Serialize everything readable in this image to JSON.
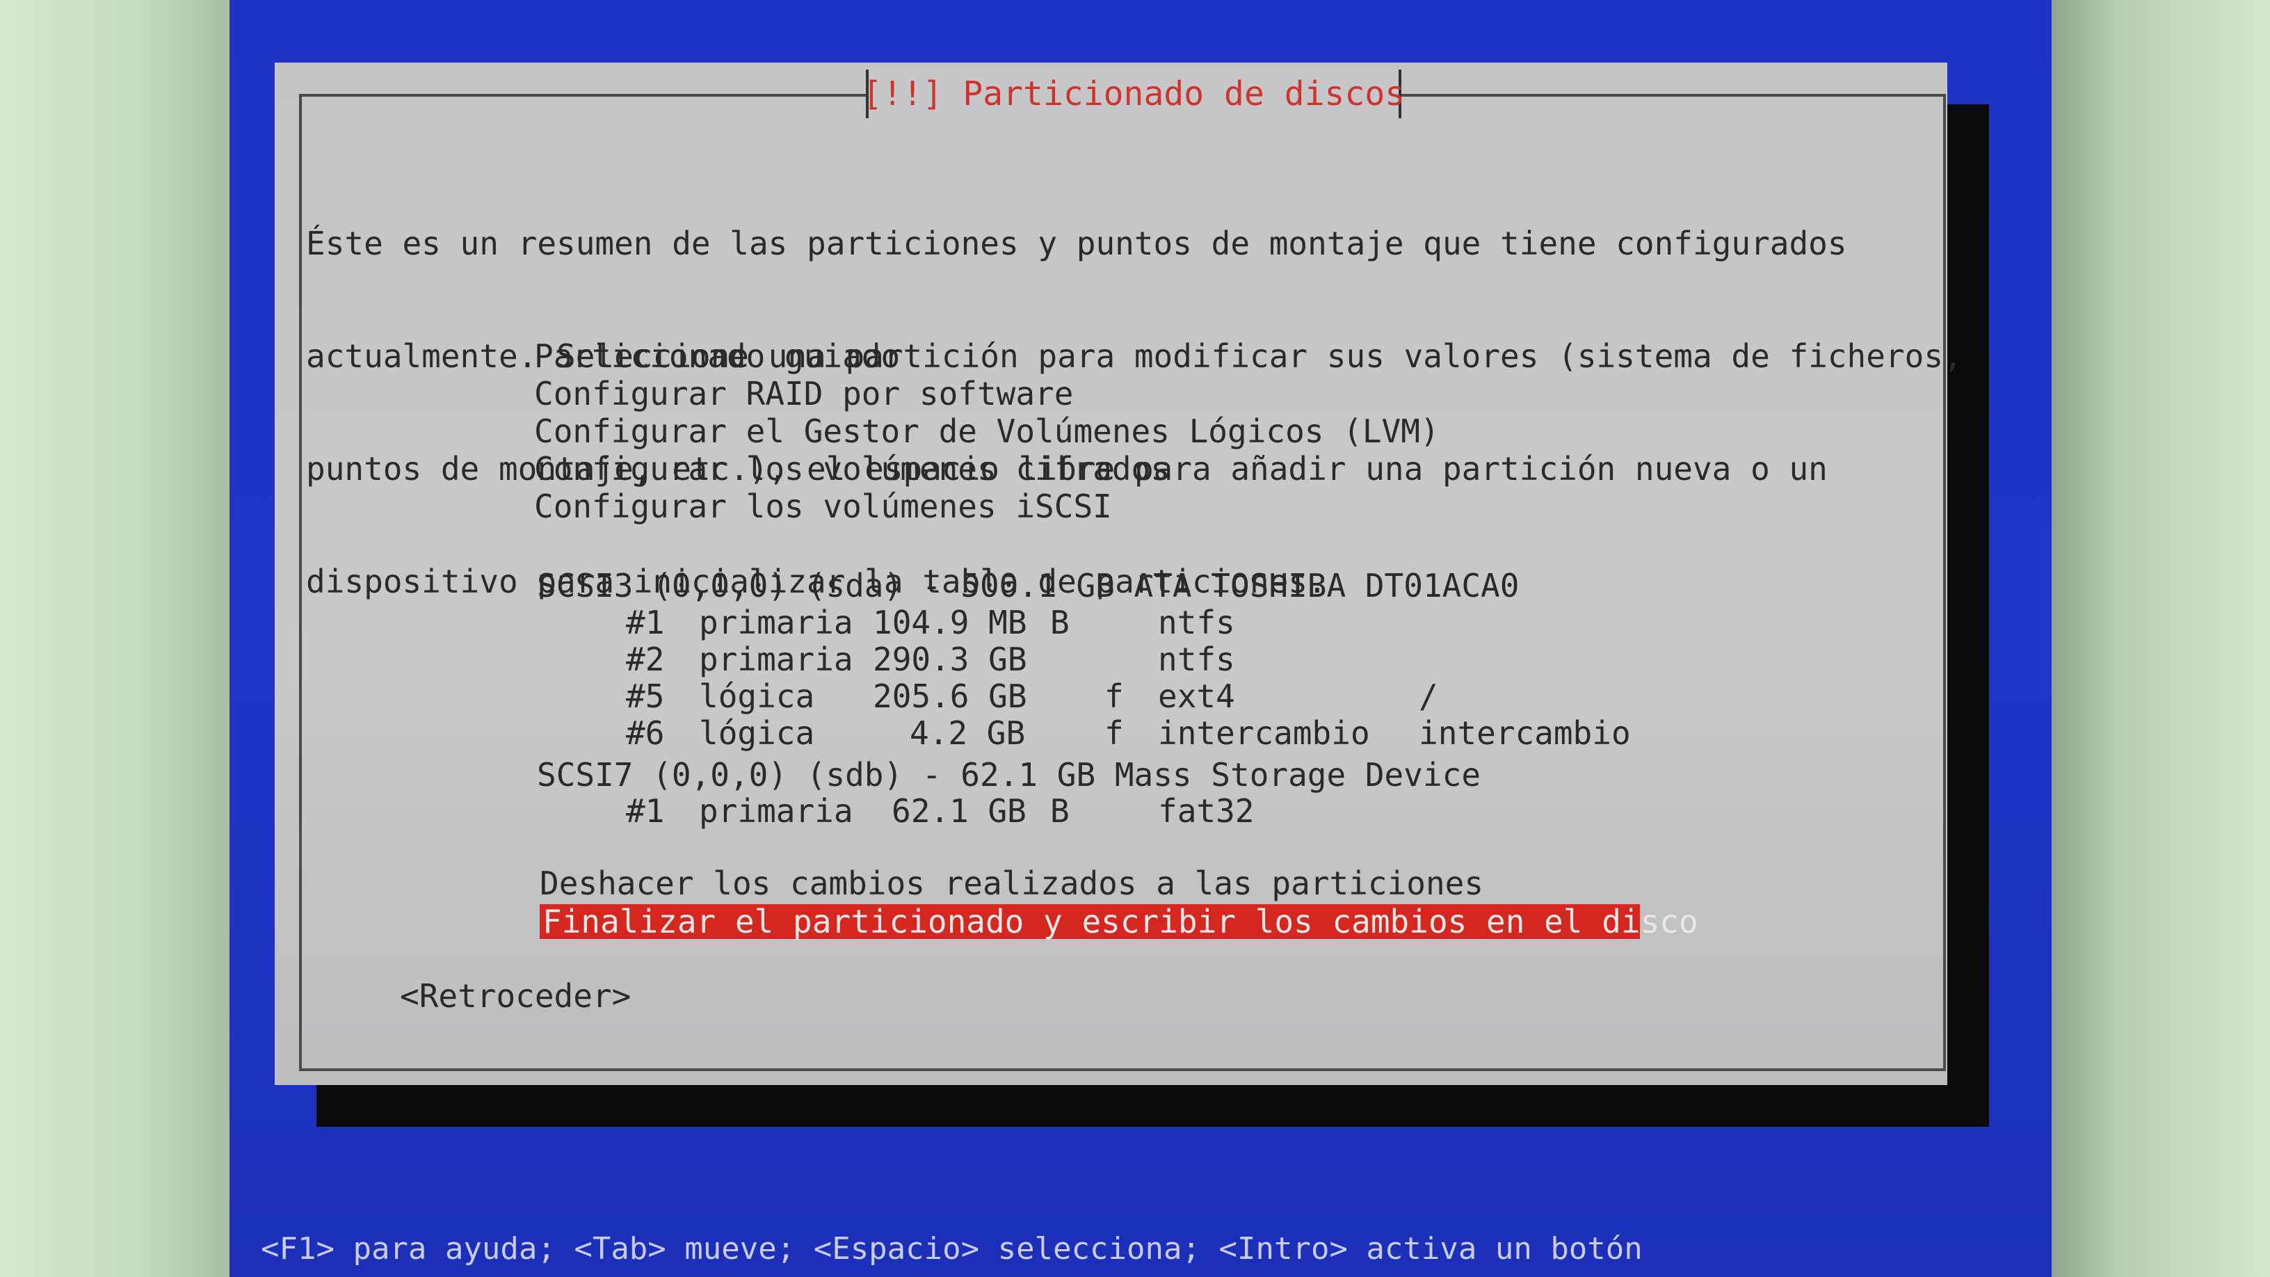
{
  "dialog": {
    "title": "[!!] Particionado de discos",
    "intro": [
      "Éste es un resumen de las particiones y puntos de montaje que tiene configurados",
      "actualmente. Seleccione una partición para modificar sus valores (sistema de ficheros,",
      "puntos de montaje, etc.), el espacio libre para añadir una partición nueva o un",
      "dispositivo para inicializar la tabla de particiones."
    ],
    "menu": [
      "Particionado guiado",
      "Configurar RAID por software",
      "Configurar el Gestor de Volúmenes Lógicos (LVM)",
      "Configurar los volúmenes cifrados",
      "Configurar los volúmenes iSCSI"
    ],
    "disks": [
      {
        "label": "SCSI3 (0,0,0) (sda) - 500.1 GB ATA TOSHIBA DT01ACA0",
        "partitions": [
          {
            "num": "#1",
            "type": "primaria",
            "size": "104.9 MB",
            "flag": "B",
            "fs": "ntfs",
            "mount": ""
          },
          {
            "num": "#2",
            "type": "primaria",
            "size": "290.3 GB",
            "flag": "",
            "fs": "ntfs",
            "mount": ""
          },
          {
            "num": "#5",
            "type": "lógica",
            "size": "205.6 GB",
            "flag": "f",
            "fs": "ext4",
            "mount": "/"
          },
          {
            "num": "#6",
            "type": "lógica",
            "size": "4.2 GB",
            "flag": "f",
            "fs": "intercambio",
            "mount": "intercambio"
          }
        ]
      },
      {
        "label": "SCSI7 (0,0,0) (sdb) - 62.1 GB Mass Storage Device",
        "partitions": [
          {
            "num": "#1",
            "type": "primaria",
            "size": "62.1 GB",
            "flag": "B",
            "fs": "fat32",
            "mount": ""
          }
        ]
      }
    ],
    "undo": "Deshacer los cambios realizados a las particiones",
    "finish": "Finalizar el particionado y escribir los cambios en el disco",
    "back": "<Retroceder>"
  },
  "help_line": "<F1> para ayuda; <Tab> mueve; <Espacio> selecciona; <Intro> activa un botón"
}
